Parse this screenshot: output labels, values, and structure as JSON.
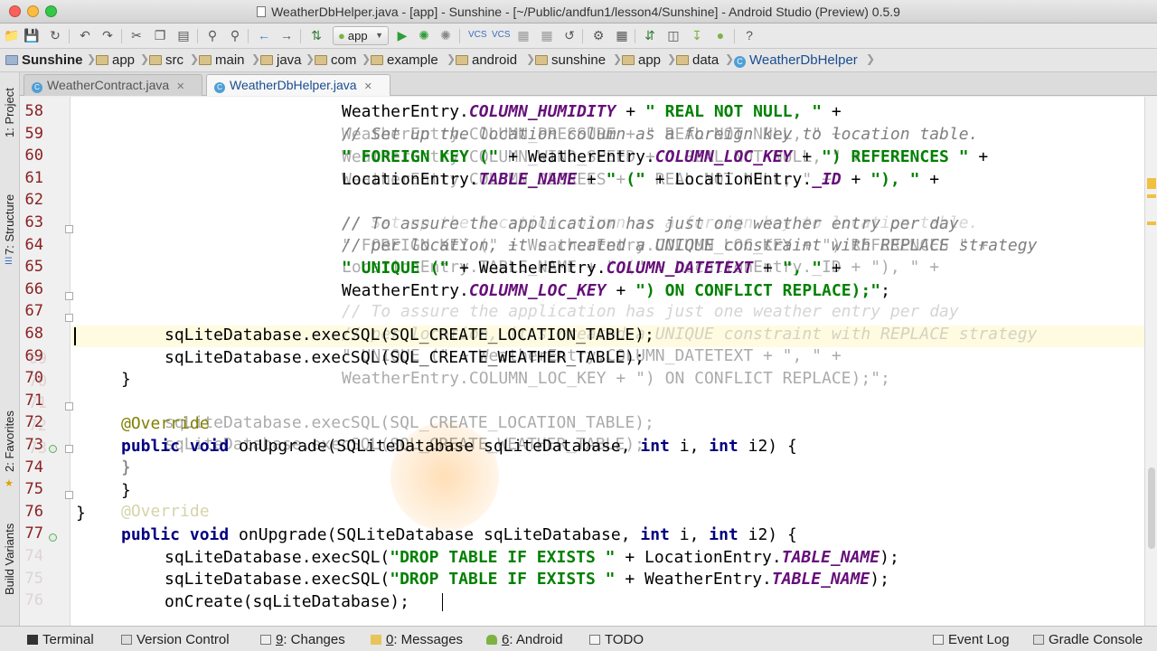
{
  "window": {
    "title": "WeatherDbHelper.java - [app] - Sunshine - [~/Public/andfun1/lesson4/Sunshine] - Android Studio (Preview) 0.5.9"
  },
  "toolbar": {
    "run_config": "app"
  },
  "breadcrumbs": [
    "Sunshine",
    "app",
    "src",
    "main",
    "java",
    "com",
    "example",
    "android",
    "sunshine",
    "app",
    "data",
    "WeatherDbHelper"
  ],
  "tabs": [
    {
      "label": "WeatherContract.java",
      "active": false
    },
    {
      "label": "WeatherDbHelper.java",
      "active": true
    }
  ],
  "left_tools": {
    "project": "1: Project",
    "structure": "7: Structure",
    "favorites": "2: Favorites",
    "build_variants": "Build Variants"
  },
  "editor": {
    "line_numbers": [
      "58",
      "59",
      "60",
      "61",
      "62",
      "63",
      "64",
      "65",
      "66",
      "67",
      "68",
      "69",
      "70",
      "71",
      "72",
      "73",
      "74",
      "75",
      "76",
      "77",
      "74",
      "75",
      "76"
    ],
    "ghost_numbers": [
      "69",
      "70",
      "71",
      "72",
      "73"
    ],
    "code": {
      "l58a": "WeatherEntry.",
      "l58b": "COLUMN_HUMIDITY",
      "l58c": " + ",
      "l58d": "\" REAL NOT NULL, \"",
      "l58e": " +",
      "l59": "// Set up the location column as a foreign key to location table.",
      "l60a": "\" FOREIGN KEY (\"",
      "l60b": " + WeatherEntry.",
      "l60c": "COLUMN_LOC_KEY",
      "l60d": " + ",
      "l60e": "\") REFERENCES \"",
      "l60f": " +",
      "l61a": "LocationEntry.",
      "l61b": "TABLE_NAME",
      "l61c": " + ",
      "l61d": "\" (\"",
      "l61e": " + LocationEntry.",
      "l61f": "_ID",
      "l61g": " + ",
      "l61h": "\"), \"",
      "l61i": " +",
      "l63": "// To assure the application has just one weather entry per day",
      "l64": "// per location, it's created a UNIQUE constraint with REPLACE strategy",
      "l65a": "\" UNIQUE (\"",
      "l65b": " + WeatherEntry.",
      "l65c": "COLUMN_DATETEXT",
      "l65d": " + ",
      "l65e": "\", \"",
      "l65f": " +",
      "l66a": "WeatherEntry.",
      "l66b": "COLUMN_LOC_KEY",
      "l66c": " + ",
      "l66d": "\") ON CONFLICT REPLACE);\"",
      "l66e": ";",
      "l68": "sqLiteDatabase.execSQL(SQL_CREATE_LOCATION_TABLE);",
      "l69": "sqLiteDatabase.execSQL(SQL_CREATE_WEATHER_TABLE);",
      "l70": "}",
      "l72": "@Override",
      "l73a": "public void",
      "l73b": " onUpgrade(SQLiteDatabase sqLiteDatabase, ",
      "l73c": "int",
      "l73d": " i, ",
      "l73e": "int",
      "l73f": " i2) {",
      "l74": "}",
      "l75": "}",
      "l76": "}",
      "l74b_a": "sqLiteDatabase.execSQL(",
      "l74b_b": "\"DROP TABLE IF EXISTS \"",
      "l74b_c": " + LocationEntry.",
      "l74b_d": "TABLE_NAME",
      "l74b_e": ");",
      "l75b_a": "sqLiteDatabase.execSQL(",
      "l75b_b": "\"DROP TABLE IF EXISTS \"",
      "l75b_c": " + WeatherEntry.",
      "l75b_d": "TABLE_NAME",
      "l75b_e": ");",
      "l76b": "onCreate(sqLiteDatabase);",
      "ghost_weather_humidity": "WeatherEntry.COLUMN_PRESSURE + \" REAL NOT NULL, \" +",
      "ghost_wind": "WeatherEntry.COLUMN_WIND_SPEED + \" REAL NOT NULL, \" +",
      "ghost_degrees": "WeatherEntry.COLUMN_DEGREES + \" REAL NOT NULL, \" +",
      "ghost_cmt1": "// Set up the location column as a foreign key to location table.",
      "ghost_fk": "\" FOREIGN KEY (\" + WeatherEntry.COLUMN_LOC_KEY + \") REFERENCES \" +",
      "ghost_loc": "LocationEntry.TABLE_NAME + \" (\" + LocationEntry._ID + \"), \" +",
      "ghost_cmt2": "// To assure the application has just one weather entry per day",
      "ghost_cmt3": "// per location, it's created a UNIQUE constraint with REPLACE strategy",
      "ghost_unique": "\" UNIQUE (\" + WeatherEntry.COLUMN_DATETEXT + \", \" +",
      "ghost_conflict": "WeatherEntry.COLUMN_LOC_KEY + \") ON CONFLICT REPLACE);\";",
      "ghost_exec1": "sqLiteDatabase.execSQL(SQL_CREATE_LOCATION_TABLE);",
      "ghost_exec2": "sqLiteDatabase.execSQL(SQL_CREATE_WEATHER_TABLE);",
      "ghost_brace": "}",
      "ghost_override": "@Override"
    }
  },
  "bottom_tools": {
    "terminal": "Terminal",
    "version_control": "Version Control",
    "changes_num": "9",
    "changes": ": Changes",
    "messages_num": "0",
    "messages": ": Messages",
    "android_num": "6",
    "android": ": Android",
    "todo": "TODO",
    "event_log": "Event Log",
    "gradle_console": "Gradle Console"
  },
  "colors": {
    "keyword": "#000080",
    "string": "#008000",
    "field": "#660e7a",
    "comment": "#808080",
    "annotation": "#808000",
    "line_number": "#8a2020",
    "caret_line": "#fffbe1"
  }
}
